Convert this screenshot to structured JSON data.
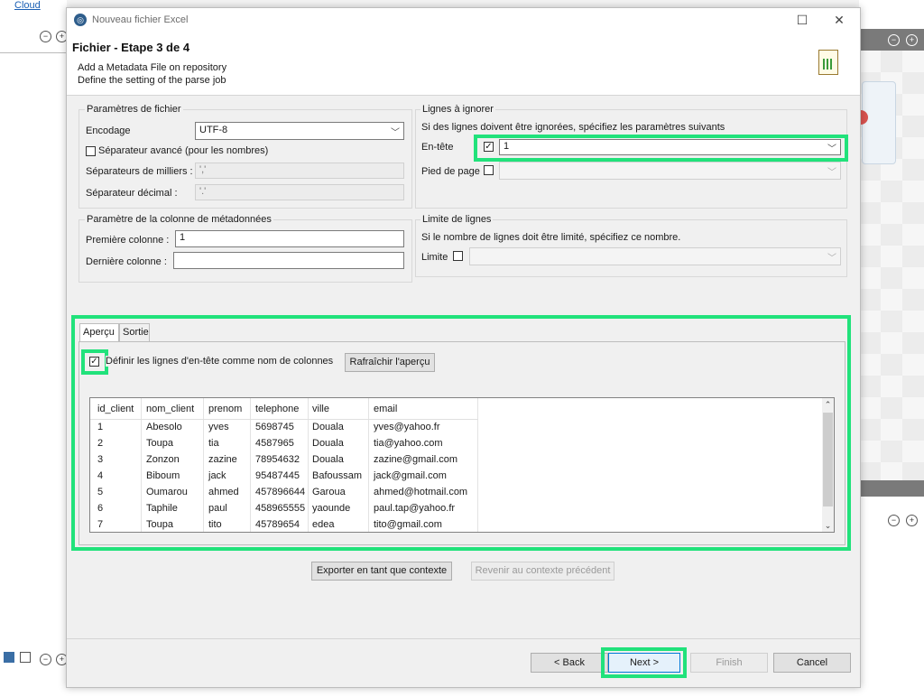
{
  "background_app": {
    "cloud_link": "Cloud"
  },
  "dialog": {
    "title": "Nouveau fichier Excel",
    "step_title": "Fichier - Etape 3 de 4",
    "step_desc1": "Add a Metadata File on repository",
    "step_desc2": "Define the setting of the parse job"
  },
  "file_params": {
    "group_label": "Paramètres de fichier",
    "encoding_label": "Encodage",
    "encoding_value": "UTF-8",
    "advanced_sep_label": "Séparateur avancé (pour les nombres)",
    "advanced_sep_checked": false,
    "thousands_label": "Séparateurs de milliers :",
    "thousands_value": "','",
    "decimal_label": "Séparateur décimal :",
    "decimal_value": "'.'"
  },
  "metadata_column": {
    "group_label": "Paramètre de la colonne de métadonnées",
    "first_label": "Première colonne :",
    "first_value": "1",
    "last_label": "Dernière colonne :",
    "last_value": ""
  },
  "ignore_lines": {
    "group_label": "Lignes à ignorer",
    "desc": "Si des lignes doivent être ignorées, spécifiez les paramètres suivants",
    "header_label": "En-tête",
    "header_checked": true,
    "header_value": "1",
    "footer_label": "Pied de page",
    "footer_checked": false,
    "footer_value": ""
  },
  "limit": {
    "group_label": "Limite de lignes",
    "desc": "Si le nombre de lignes doit être limité, spécifiez ce nombre.",
    "limit_label": "Limite",
    "limit_checked": false,
    "limit_value": ""
  },
  "tabs": [
    {
      "label": "Aperçu",
      "active": true
    },
    {
      "label": "Sortie",
      "active": false
    }
  ],
  "preview": {
    "set_header_label": "Définir les lignes d'en-tête comme nom de colonnes",
    "set_header_checked": true,
    "refresh_label": "Rafraîchir l'aperçu",
    "columns": [
      "id_client",
      "nom_client",
      "prenom",
      "telephone",
      "ville",
      "email"
    ],
    "rows": [
      [
        "1",
        "Abesolo",
        "yves",
        "5698745",
        "Douala",
        "yves@yahoo.fr"
      ],
      [
        "2",
        "Toupa",
        "tia",
        "4587965",
        "Douala",
        "tia@yahoo.com"
      ],
      [
        "3",
        "Zonzon",
        "zazine",
        "78954632",
        "Douala",
        "zazine@gmail.com"
      ],
      [
        "4",
        "Biboum",
        "jack",
        "95487445",
        "Bafoussam",
        "jack@gmail.com"
      ],
      [
        "5",
        "Oumarou",
        "ahmed",
        "457896644",
        "Garoua",
        "ahmed@hotmail.com"
      ],
      [
        "6",
        "Taphile",
        "paul",
        "458965555",
        "yaounde",
        "paul.tap@yahoo.fr"
      ],
      [
        "7",
        "Toupa",
        "tito",
        "45789654",
        "edea",
        "tito@gmail.com"
      ]
    ]
  },
  "context_buttons": {
    "export_label": "Exporter en tant que contexte",
    "revert_label": "Revenir au contexte précédent"
  },
  "footer_buttons": {
    "back_label": "< Back",
    "next_label": "Next >",
    "finish_label": "Finish",
    "cancel_label": "Cancel"
  },
  "colors": {
    "highlight": "#21e27b",
    "dialog_bg": "#f0f0f0"
  }
}
